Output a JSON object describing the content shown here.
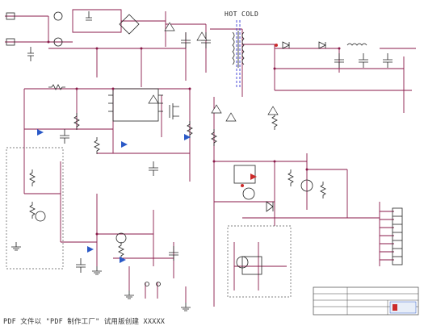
{
  "schematic": {
    "hot_label": "HOT",
    "cold_label": "COLD"
  },
  "footer": {
    "text": "PDF 文件以 \"PDF 制作工厂\" 试用版创建 XXXXX"
  },
  "colors": {
    "wire": "#8a1a4a",
    "ink": "#222222",
    "divider": "#3b3bd6",
    "box": "#555555",
    "accent_blue": "#2a59c7",
    "accent_red": "#cc2a2a"
  }
}
